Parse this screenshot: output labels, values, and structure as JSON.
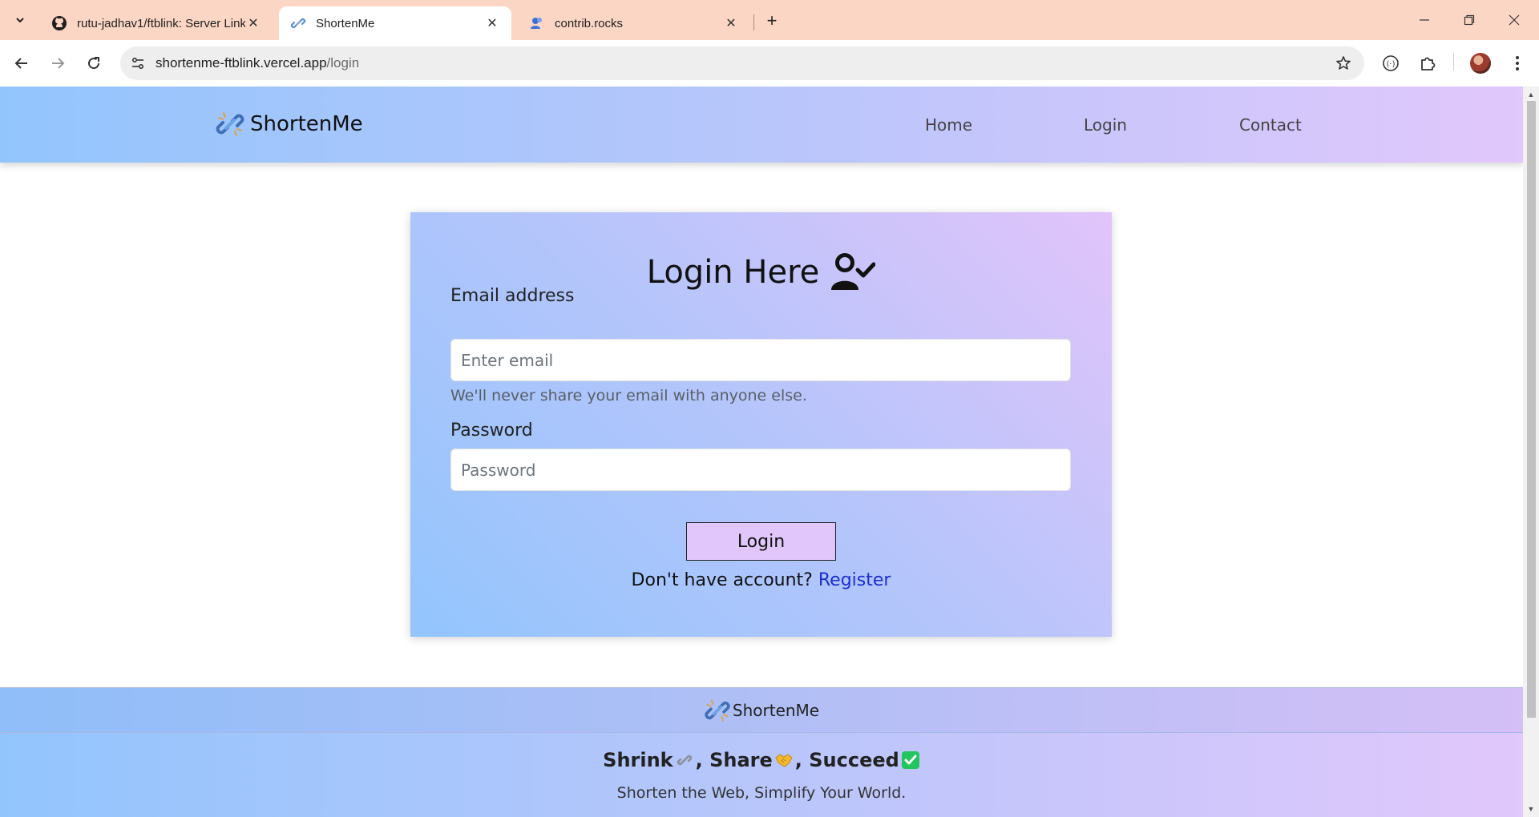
{
  "browser": {
    "tabs": [
      {
        "title": "rutu-jadhav1/ftblink: Server Link",
        "icon": "github-icon",
        "active": false
      },
      {
        "title": "ShortenMe",
        "icon": "link-icon",
        "active": true
      },
      {
        "title": "contrib.rocks",
        "icon": "contrib-icon",
        "active": false
      }
    ],
    "url_host": "shortenme-ftblink.vercel.app",
    "url_path": "/login"
  },
  "site": {
    "brand": "ShortenMe",
    "nav": {
      "home": "Home",
      "login": "Login",
      "contact": "Contact"
    }
  },
  "login": {
    "title": "Login Here",
    "email_label": "Email address",
    "email_placeholder": "Enter email",
    "email_help": "We'll never share your email with anyone else.",
    "password_label": "Password",
    "password_placeholder": "Password",
    "submit_label": "Login",
    "register_prompt": "Don't have account?",
    "register_link": "Register"
  },
  "footer": {
    "brand": "ShortenMe",
    "tagline_parts": [
      "Shrink",
      ", Share",
      ", Succeed"
    ],
    "subtagline": "Shorten the Web, Simplify Your World."
  },
  "colors": {
    "accent_blue": "#93c5fd",
    "accent_purple": "#e1c7fb",
    "link": "#1a2ed6",
    "check_green": "#22c55e"
  }
}
